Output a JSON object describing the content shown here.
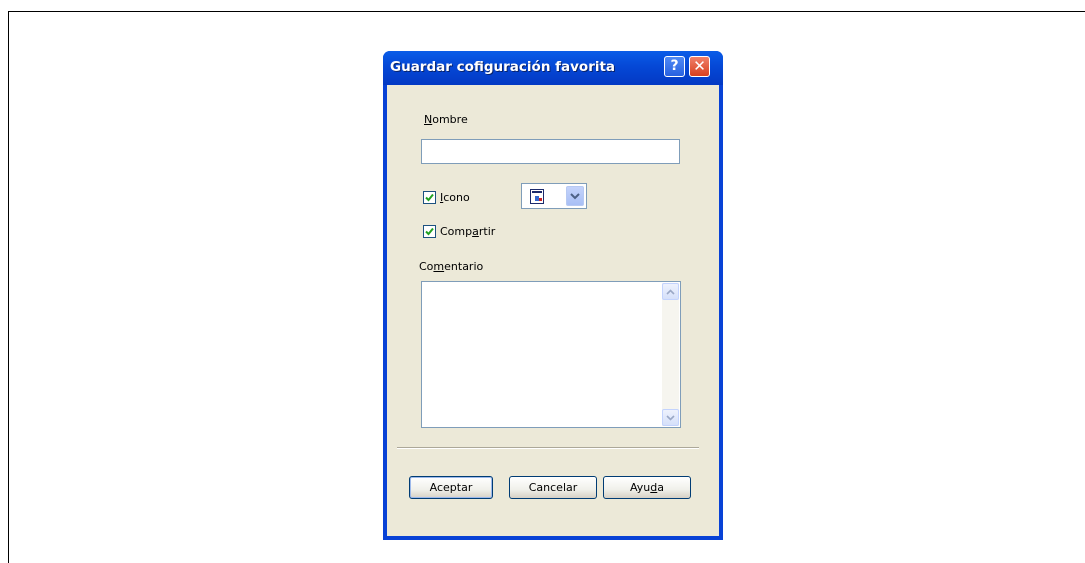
{
  "dialog": {
    "title": "Guardar cofiguración favorita",
    "help_button": "?",
    "close_button": "✕"
  },
  "form": {
    "name_label_accel": "N",
    "name_label_rest": "ombre",
    "name_value": "",
    "icon_checkbox": {
      "checked": true,
      "label_accel": "I",
      "label_rest": "cono"
    },
    "icon_select": {
      "selected_icon": "document-icon"
    },
    "share_checkbox": {
      "checked": true,
      "label_pre": "Comp",
      "label_accel": "a",
      "label_post": "rtir"
    },
    "comment_label_pre": "Co",
    "comment_label_accel": "m",
    "comment_label_post": "entario",
    "comment_value": ""
  },
  "buttons": {
    "ok": "Aceptar",
    "cancel": "Cancelar",
    "help_pre": "Ayu",
    "help_accel": "d",
    "help_post": "a"
  },
  "colors": {
    "titlebar": "#0842d6",
    "client_bg": "#ece9d8",
    "close_button": "#d8401e"
  }
}
